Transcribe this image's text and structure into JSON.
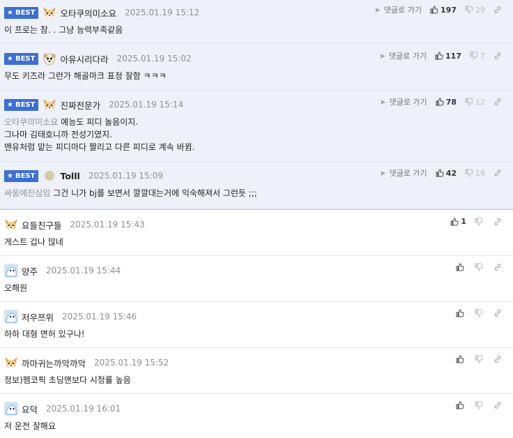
{
  "ui": {
    "best_label": "BEST",
    "reply_link_label": "댓글로 가기"
  },
  "colors": {
    "best_bg": "#eef1f9",
    "badge": "#3b6fd6",
    "date": "#8a8f99"
  },
  "best_comments": [
    {
      "nickname": "오타쿠의미소요",
      "avatar": "fox-avatar",
      "date": "2025.01.19 15:12",
      "lines": [
        "이 프로는 참. . 그냥 능력부족같음"
      ],
      "mention": "",
      "up": "197",
      "down": "29"
    },
    {
      "nickname": "아유시리다라",
      "avatar": "dog-avatar",
      "date": "2025.01.19 15:02",
      "lines": [
        "무도 키즈라 그런가 해골마크 표정 잘함 ㅋㅋㅋ"
      ],
      "mention": "",
      "up": "117",
      "down": "7"
    },
    {
      "nickname": "진짜전문가",
      "avatar": "fox-avatar",
      "date": "2025.01.19 15:14",
      "mention": "오타쿠의미소요",
      "lines": [
        "예능도 피디 놀음이지.",
        "그나마 김태호니까 전성기였지.",
        "맨유처럼 맡는 피디마다 짤리고 다른 피디로 계속 바뀜."
      ],
      "up": "78",
      "down": "12"
    },
    {
      "nickname": "Tolll",
      "avatar": "pebble-avatar",
      "date": "2025.01.19 15:09",
      "mention": "싸움에진심임",
      "lines": [
        "그건 니가 bj를 보면서 깔깔대는거에 익숙해져서 그런듯 ;;;"
      ],
      "up": "42",
      "down": "18"
    }
  ],
  "comments": [
    {
      "nickname": "요들친구들",
      "avatar": "fox-avatar",
      "date": "2025.01.19 15:43",
      "text": "게스트 겁나 많네",
      "up": "1"
    },
    {
      "nickname": "양주",
      "avatar": "blue-avatar",
      "date": "2025.01.19 15:44",
      "text": "오해원",
      "up": ""
    },
    {
      "nickname": "저우쯔위",
      "avatar": "blue-avatar",
      "date": "2025.01.19 15:46",
      "text": "하하 대형 면허 있구나!",
      "up": ""
    },
    {
      "nickname": "까마귀는까악까악",
      "avatar": "fox-avatar",
      "date": "2025.01.19 15:52",
      "text": "정보)펨코픽 초딩맨보다 시청률 높음",
      "up": ""
    },
    {
      "nickname": "요덕",
      "avatar": "blue-avatar",
      "date": "2025.01.19 16:01",
      "text": "저 운전 잘해요",
      "up": ""
    }
  ]
}
